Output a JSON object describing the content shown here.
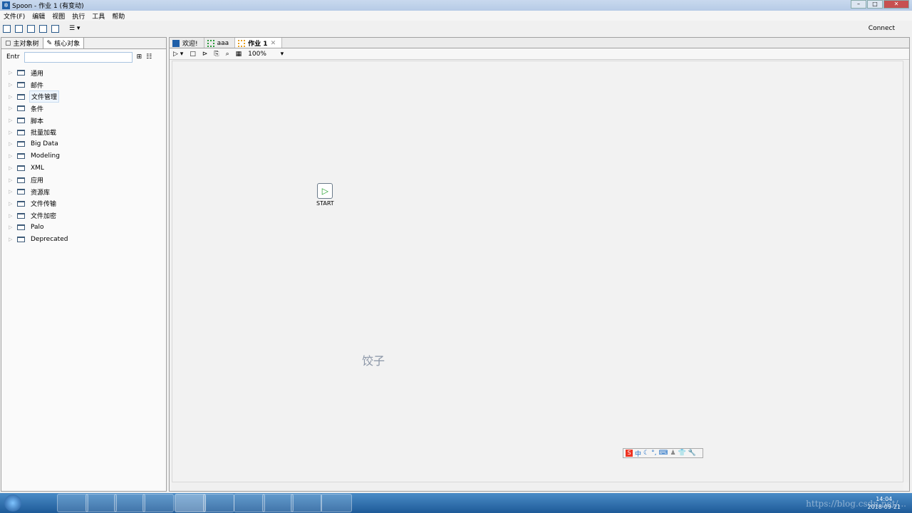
{
  "window": {
    "title": "Spoon - 作业 1 (有变动)"
  },
  "menu": [
    "文件(F)",
    "编辑",
    "视图",
    "执行",
    "工具",
    "帮助"
  ],
  "toolbar": {
    "connect": "Connect"
  },
  "left": {
    "tabs": [
      "主对象树",
      "核心对象"
    ],
    "search_label": "Entr",
    "search_value": "",
    "tree": [
      "通用",
      "邮件",
      "文件管理",
      "条件",
      "脚本",
      "批量加载",
      "Big Data",
      "Modeling",
      "XML",
      "应用",
      "资源库",
      "文件传输",
      "文件加密",
      "Palo",
      "Deprecated"
    ]
  },
  "right": {
    "tabs": [
      "欢迎!",
      "aaa",
      "作业 1"
    ],
    "zoom": "100%"
  },
  "canvas": {
    "start_label": "START",
    "note": "饺子"
  },
  "ime": {
    "logo": "S",
    "mode": "中"
  },
  "taskbar": {
    "time": "14:04",
    "date": "2018-09-21",
    "watermark": "https://blog.csdn.net/..."
  }
}
